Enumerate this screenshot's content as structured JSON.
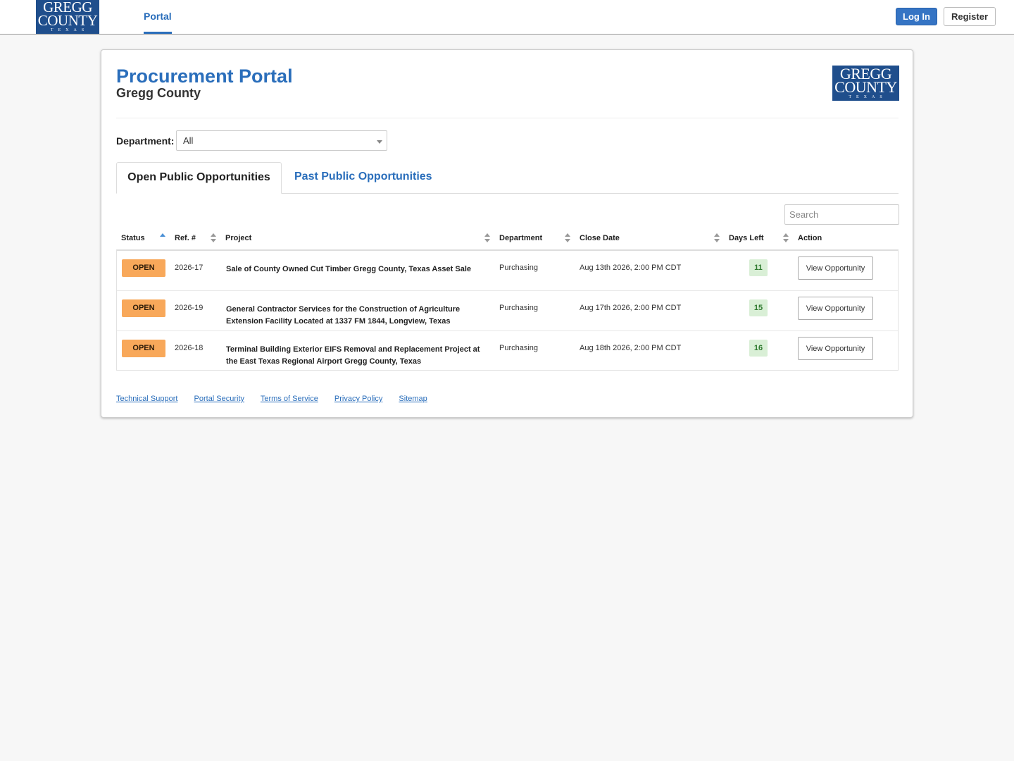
{
  "brand": {
    "logo_line1": "GREGG",
    "logo_line2": "COUNTY",
    "logo_line3": "TEXAS",
    "color": "#1f4e8c"
  },
  "nav": {
    "portal_label": "Portal",
    "login_label": "Log In",
    "register_label": "Register"
  },
  "header": {
    "title": "Procurement Portal",
    "subtitle": "Gregg County"
  },
  "filter": {
    "department_label": "Department:",
    "department_value": "All"
  },
  "tabs": [
    {
      "label": "Open Public Opportunities",
      "active": true
    },
    {
      "label": "Past Public Opportunities",
      "active": false
    }
  ],
  "search": {
    "placeholder": "Search",
    "value": ""
  },
  "table": {
    "columns": [
      "Status",
      "Ref. #",
      "Project",
      "Department",
      "Close Date",
      "Days Left",
      "Action"
    ],
    "rows": [
      {
        "status": "OPEN",
        "ref": "2026-17",
        "project": "Sale of County Owned Cut Timber Gregg County, Texas Asset Sale",
        "department": "Purchasing",
        "close_date": "Aug 13th 2026, 2:00 PM CDT",
        "days_left": "11",
        "action": "View Opportunity"
      },
      {
        "status": "OPEN",
        "ref": "2026-19",
        "project": "General Contractor Services for the Construction of Agriculture Extension Facility Located at 1337 FM 1844, Longview, Texas",
        "department": "Purchasing",
        "close_date": "Aug 17th 2026, 2:00 PM CDT",
        "days_left": "15",
        "action": "View Opportunity"
      },
      {
        "status": "OPEN",
        "ref": "2026-18",
        "project": "Terminal Building Exterior EIFS Removal and Replacement Project at the East Texas Regional Airport Gregg County, Texas",
        "department": "Purchasing",
        "close_date": "Aug 18th 2026, 2:00 PM CDT",
        "days_left": "16",
        "action": "View Opportunity"
      }
    ]
  },
  "footer": {
    "links": [
      "Technical Support",
      "Portal Security",
      "Terms of Service",
      "Privacy Policy",
      "Sitemap"
    ]
  },
  "colors": {
    "accent": "#2a6ebb",
    "open_badge": "#f8a85a",
    "days_badge": "#d9efd6"
  }
}
